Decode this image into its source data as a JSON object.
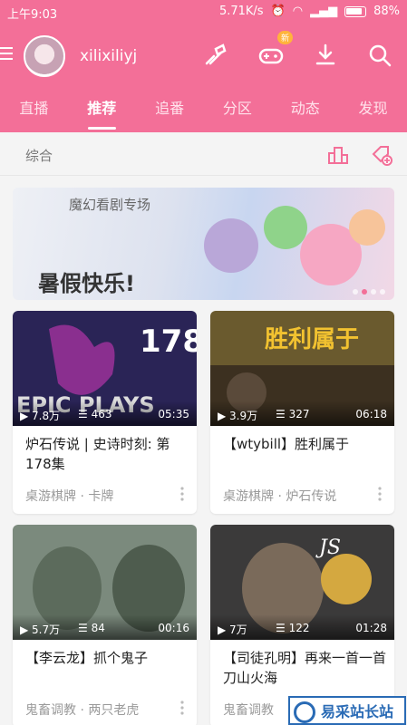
{
  "status_bar": {
    "time": "上午9:03",
    "network_speed": "5.71K/s",
    "battery": "88%"
  },
  "header": {
    "username": "xilixiliyj",
    "game_badge": "新"
  },
  "tabs": [
    {
      "label": "直播",
      "active": false
    },
    {
      "label": "推荐",
      "active": true
    },
    {
      "label": "追番",
      "active": false
    },
    {
      "label": "分区",
      "active": false
    },
    {
      "label": "动态",
      "active": false
    },
    {
      "label": "发现",
      "active": false
    }
  ],
  "section": {
    "label": "综合"
  },
  "banner": {
    "line1": "魔幻看剧专场",
    "line2": "暑假快乐!",
    "active_dot": 1,
    "dot_count": 4
  },
  "cards": [
    {
      "views": "7.8万",
      "danmaku": "463",
      "duration": "05:35",
      "title": "炉石传说 | 史诗时刻: 第178集",
      "category": "桌游棋牌 · 卡牌"
    },
    {
      "views": "3.9万",
      "danmaku": "327",
      "duration": "06:18",
      "title": "【wtybill】胜利属于",
      "category": "桌游棋牌 · 炉石传说"
    },
    {
      "views": "5.7万",
      "danmaku": "84",
      "duration": "00:16",
      "title": "【李云龙】抓个鬼子",
      "category": "鬼畜调教 · 两只老虎"
    },
    {
      "views": "7万",
      "danmaku": "122",
      "duration": "01:28",
      "title": "【司徒孔明】再来一首一首刀山火海",
      "category": "鬼畜调教"
    }
  ],
  "watermark": {
    "text": "易采站长站"
  },
  "colors": {
    "brand_pink": "#f36f98",
    "badge_orange": "#ffb43b"
  }
}
